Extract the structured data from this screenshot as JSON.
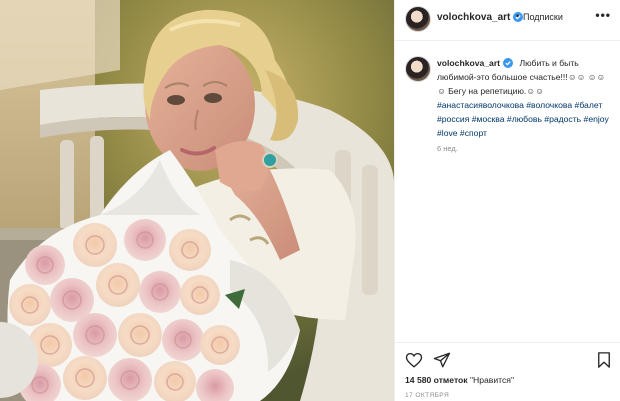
{
  "header": {
    "username": "volochkova_art",
    "separator": "•",
    "follow_label": "Подписки",
    "more_label": "•••"
  },
  "caption": {
    "username": "volochkova_art",
    "text_line1": "Любить и быть любимой-это большое счастье!!!☺☺",
    "text_line2": "☺☺☺ Бегу на репетицию.☺☺",
    "hashtags": "#анастасияволочкова #волочкова #балет #россия #москва #любовь #радость #enjoy #love #спорт",
    "time_ago": "6 нед."
  },
  "engagement": {
    "likes_count": "14 580 отметок",
    "likes_label": "\"Нравится\"",
    "date": "17 ОКТЯБРЯ"
  },
  "icons": {
    "like": "heart-icon",
    "share": "paper-plane-icon",
    "save": "bookmark-icon",
    "verified": "verified-badge-icon",
    "more": "more-options-icon"
  },
  "colors": {
    "link": "#00376b",
    "verified": "#3897f0",
    "muted": "#8e8e8e",
    "text": "#262626"
  }
}
